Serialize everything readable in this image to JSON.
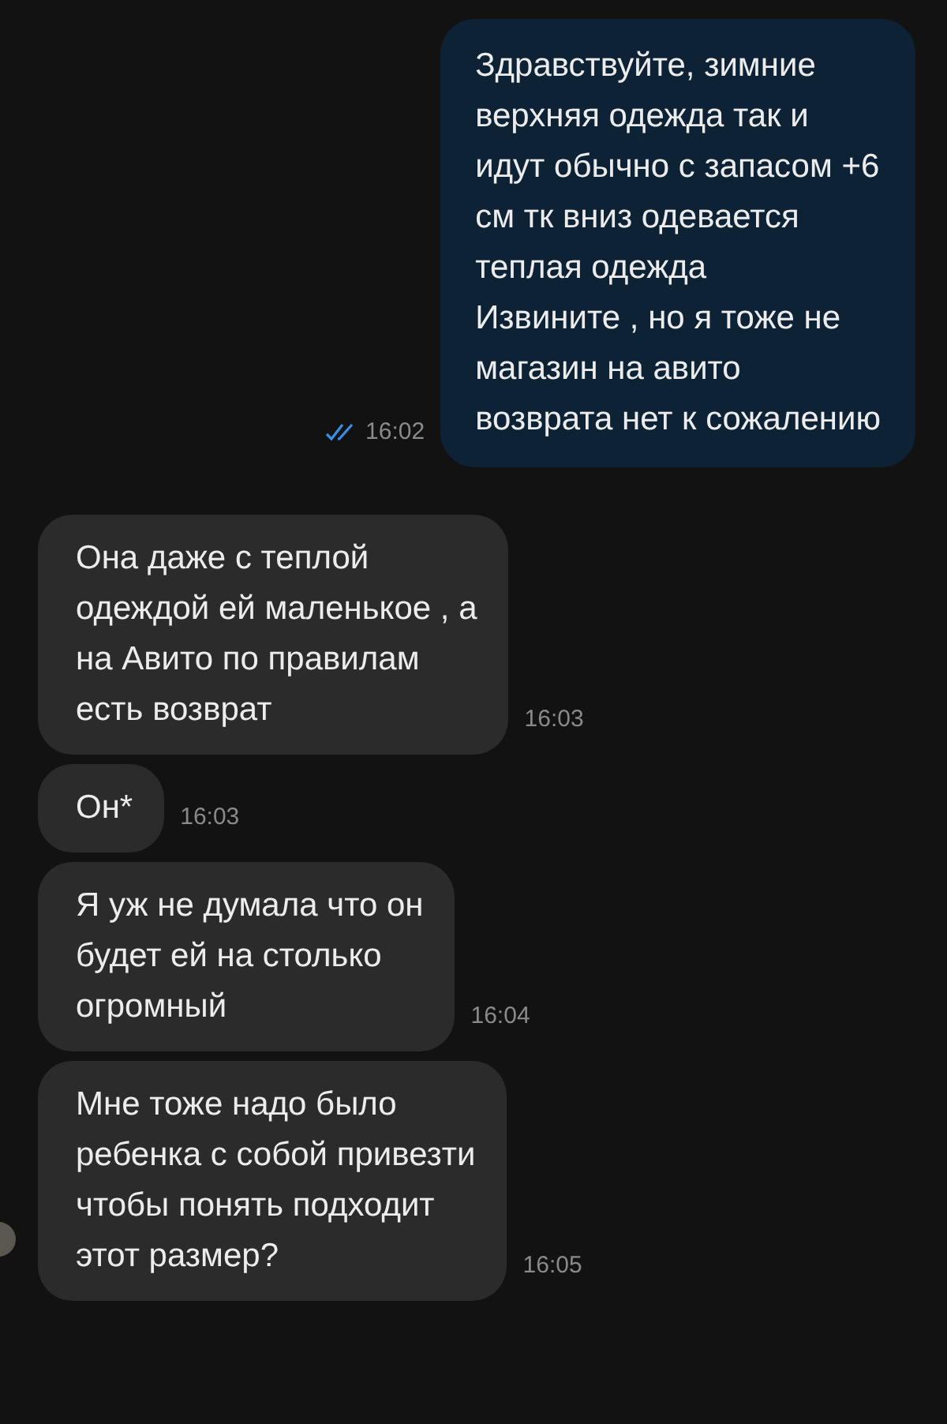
{
  "messages": [
    {
      "kind": "outgoing",
      "text": "Здравствуйте, зимние\nверхняя одежда  так и\nидут обычно с запасом +6\nсм тк вниз одевается\nтеплая одежда\nИзвините  , но я тоже не\nмагазин на авито\nвозврата нет к сожалению",
      "time": "16:02",
      "read": true
    },
    {
      "kind": "incoming",
      "text": "Она даже с теплой\nодеждой ей маленькое , а\nна Авито по правилам\nесть возврат",
      "time": "16:03"
    },
    {
      "kind": "incoming",
      "text": "Он*",
      "time": "16:03"
    },
    {
      "kind": "incoming",
      "text": "Я уж не думала что он\nбудет ей на столько\nогромный",
      "time": "16:04"
    },
    {
      "kind": "incoming",
      "text": "Мне тоже надо было\nребенка с собой привезти\nчтобы понять подходит\nэтот размер?",
      "time": "16:05",
      "avatar": true
    }
  ]
}
